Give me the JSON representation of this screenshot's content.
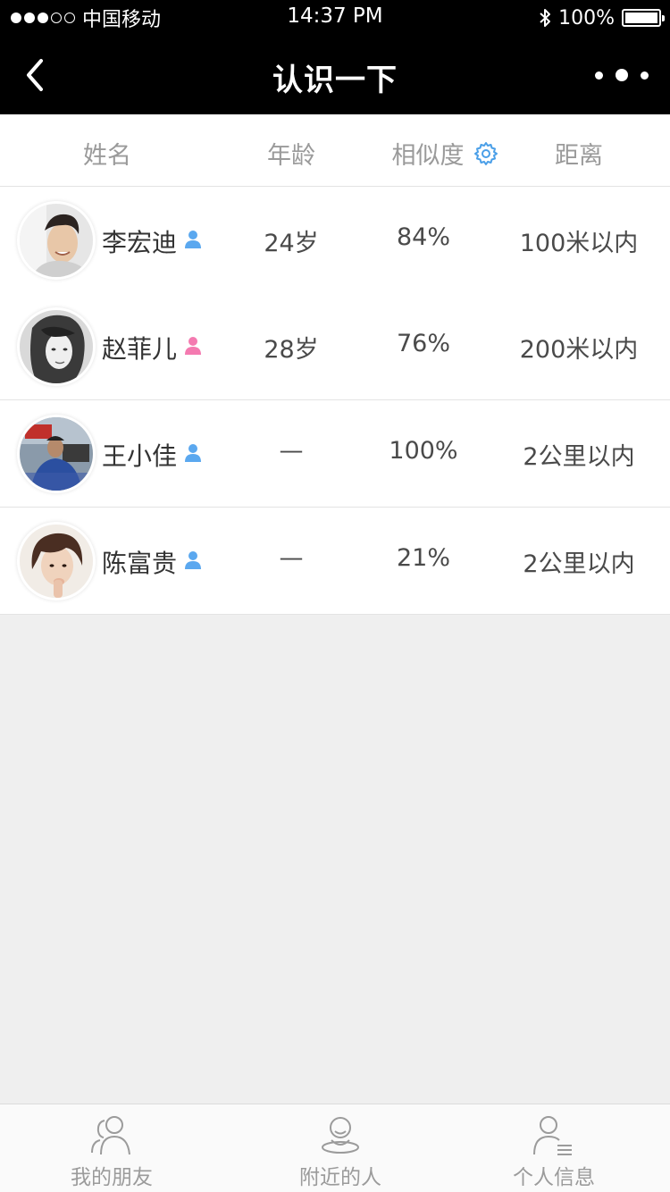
{
  "status_bar": {
    "carrier": "中国移动",
    "time": "14:37 PM",
    "battery_percent": "100%",
    "signal_bars_filled": 3,
    "signal_bars_total": 5
  },
  "nav": {
    "title": "认识一下",
    "back_icon": "chevron-left-icon",
    "more_icon": "more-dots-icon"
  },
  "list_header": {
    "name": "姓名",
    "age": "年龄",
    "similarity": "相似度",
    "distance": "距离"
  },
  "rows": [
    {
      "name": "李宏迪",
      "gender": "male",
      "age": "24岁",
      "similarity": "84%",
      "distance": "100米以内"
    },
    {
      "name": "赵菲儿",
      "gender": "female",
      "age": "28岁",
      "similarity": "76%",
      "distance": "200米以内"
    },
    {
      "name": "王小佳",
      "gender": "male",
      "age": "—",
      "similarity": "100%",
      "distance": "2公里以内"
    },
    {
      "name": "陈富贵",
      "gender": "male",
      "age": "—",
      "similarity": "21%",
      "distance": "2公里以内"
    }
  ],
  "tabs": [
    {
      "label": "我的朋友",
      "icon": "friends-icon"
    },
    {
      "label": "附近的人",
      "icon": "nearby-person-icon"
    },
    {
      "label": "个人信息",
      "icon": "profile-info-icon"
    }
  ],
  "colors": {
    "male": "#5ba8ef",
    "female": "#f47ab0",
    "accent": "#4a9fe8",
    "bar_bg": "#000000"
  }
}
